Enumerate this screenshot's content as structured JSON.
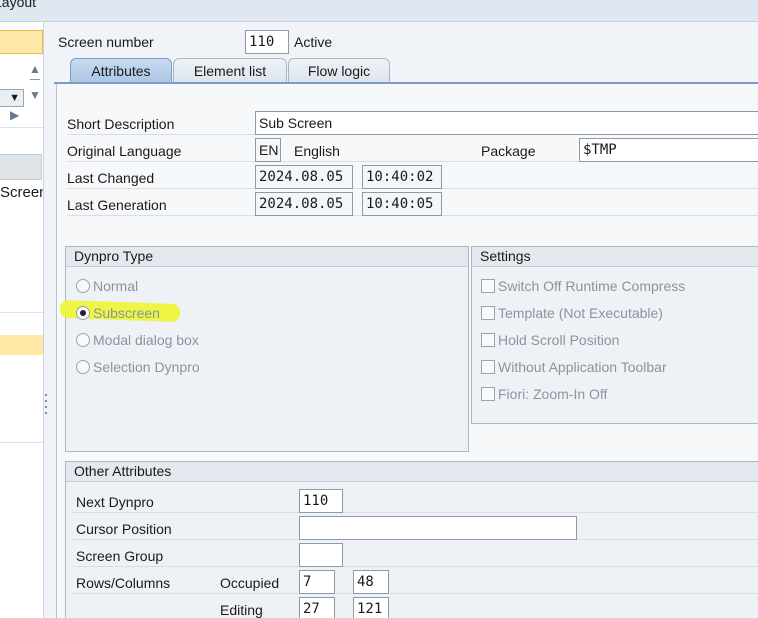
{
  "window": {
    "title": "Layout"
  },
  "left_panel": {
    "screen_text": "Screen"
  },
  "header": {
    "screen_number_label": "Screen number",
    "screen_number": "110",
    "status": "Active"
  },
  "tabs": [
    {
      "label": "Attributes",
      "active": true
    },
    {
      "label": "Element list",
      "active": false
    },
    {
      "label": "Flow logic",
      "active": false
    }
  ],
  "attributes": {
    "short_description_label": "Short Description",
    "short_description": "Sub Screen",
    "original_language_label": "Original Language",
    "language_code": "EN",
    "language_name": "English",
    "package_label": "Package",
    "package": "$TMP",
    "last_changed_label": "Last Changed",
    "last_changed_date": "2024.08.05",
    "last_changed_time": "10:40:02",
    "last_generation_label": "Last Generation",
    "last_generation_date": "2024.08.05",
    "last_generation_time": "10:40:05"
  },
  "dynpro_type": {
    "title": "Dynpro Type",
    "options": [
      {
        "label": "Normal",
        "selected": false
      },
      {
        "label": "Subscreen",
        "selected": true
      },
      {
        "label": "Modal dialog box",
        "selected": false
      },
      {
        "label": "Selection Dynpro",
        "selected": false
      }
    ]
  },
  "settings": {
    "title": "Settings",
    "options": [
      {
        "label": "Switch Off Runtime Compress",
        "checked": false
      },
      {
        "label": "Template (Not Executable)",
        "checked": false
      },
      {
        "label": "Hold Scroll Position",
        "checked": false
      },
      {
        "label": "Without Application Toolbar",
        "checked": false
      },
      {
        "label": "Fiori: Zoom-In Off",
        "checked": false
      }
    ]
  },
  "other_attributes": {
    "title": "Other Attributes",
    "next_dynpro_label": "Next Dynpro",
    "next_dynpro": "110",
    "cursor_position_label": "Cursor Position",
    "cursor_position": "",
    "screen_group_label": "Screen Group",
    "screen_group": "",
    "rows_columns_label": "Rows/Columns",
    "occupied_label": "Occupied",
    "occupied_rows": "7",
    "occupied_cols": "48",
    "editing_label": "Editing",
    "editing_rows": "27",
    "editing_cols": "121"
  },
  "colors": {
    "highlight": "#eef532",
    "active_tab": "#a9c4e6",
    "selection_yellow": "#ffe9a8"
  }
}
